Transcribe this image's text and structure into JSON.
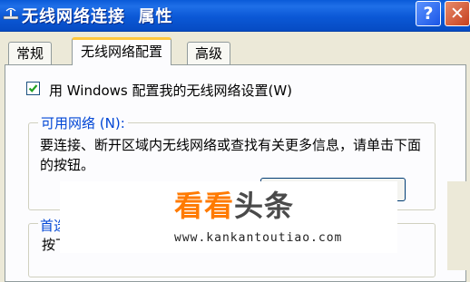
{
  "window": {
    "title": "无线网络连接  属性",
    "help_label": "?",
    "close_label": "✕"
  },
  "tabs": [
    {
      "label": "常规",
      "active": false
    },
    {
      "label": "无线网络配置",
      "active": true
    },
    {
      "label": "高级",
      "active": false
    }
  ],
  "config": {
    "use_windows_label": "用 Windows 配置我的无线网络设置(W)",
    "use_windows_checked": true
  },
  "available_networks": {
    "title": "可用网络 (N):",
    "description": "要连接、断开区域内无线网络或查找有关更多信息，请单击下面的按钮。"
  },
  "preferred_networks": {
    "title": "首选",
    "instruction": "按下"
  },
  "watermark": {
    "brand_orange": "看看",
    "brand_gray": "头条",
    "url": "www.kankantoutiao.com"
  },
  "colors": {
    "titlebar": "#0a5bd8",
    "tab_highlight": "#ffc73c",
    "group_title": "#0046d5",
    "brand_orange": "#ff7a00"
  }
}
